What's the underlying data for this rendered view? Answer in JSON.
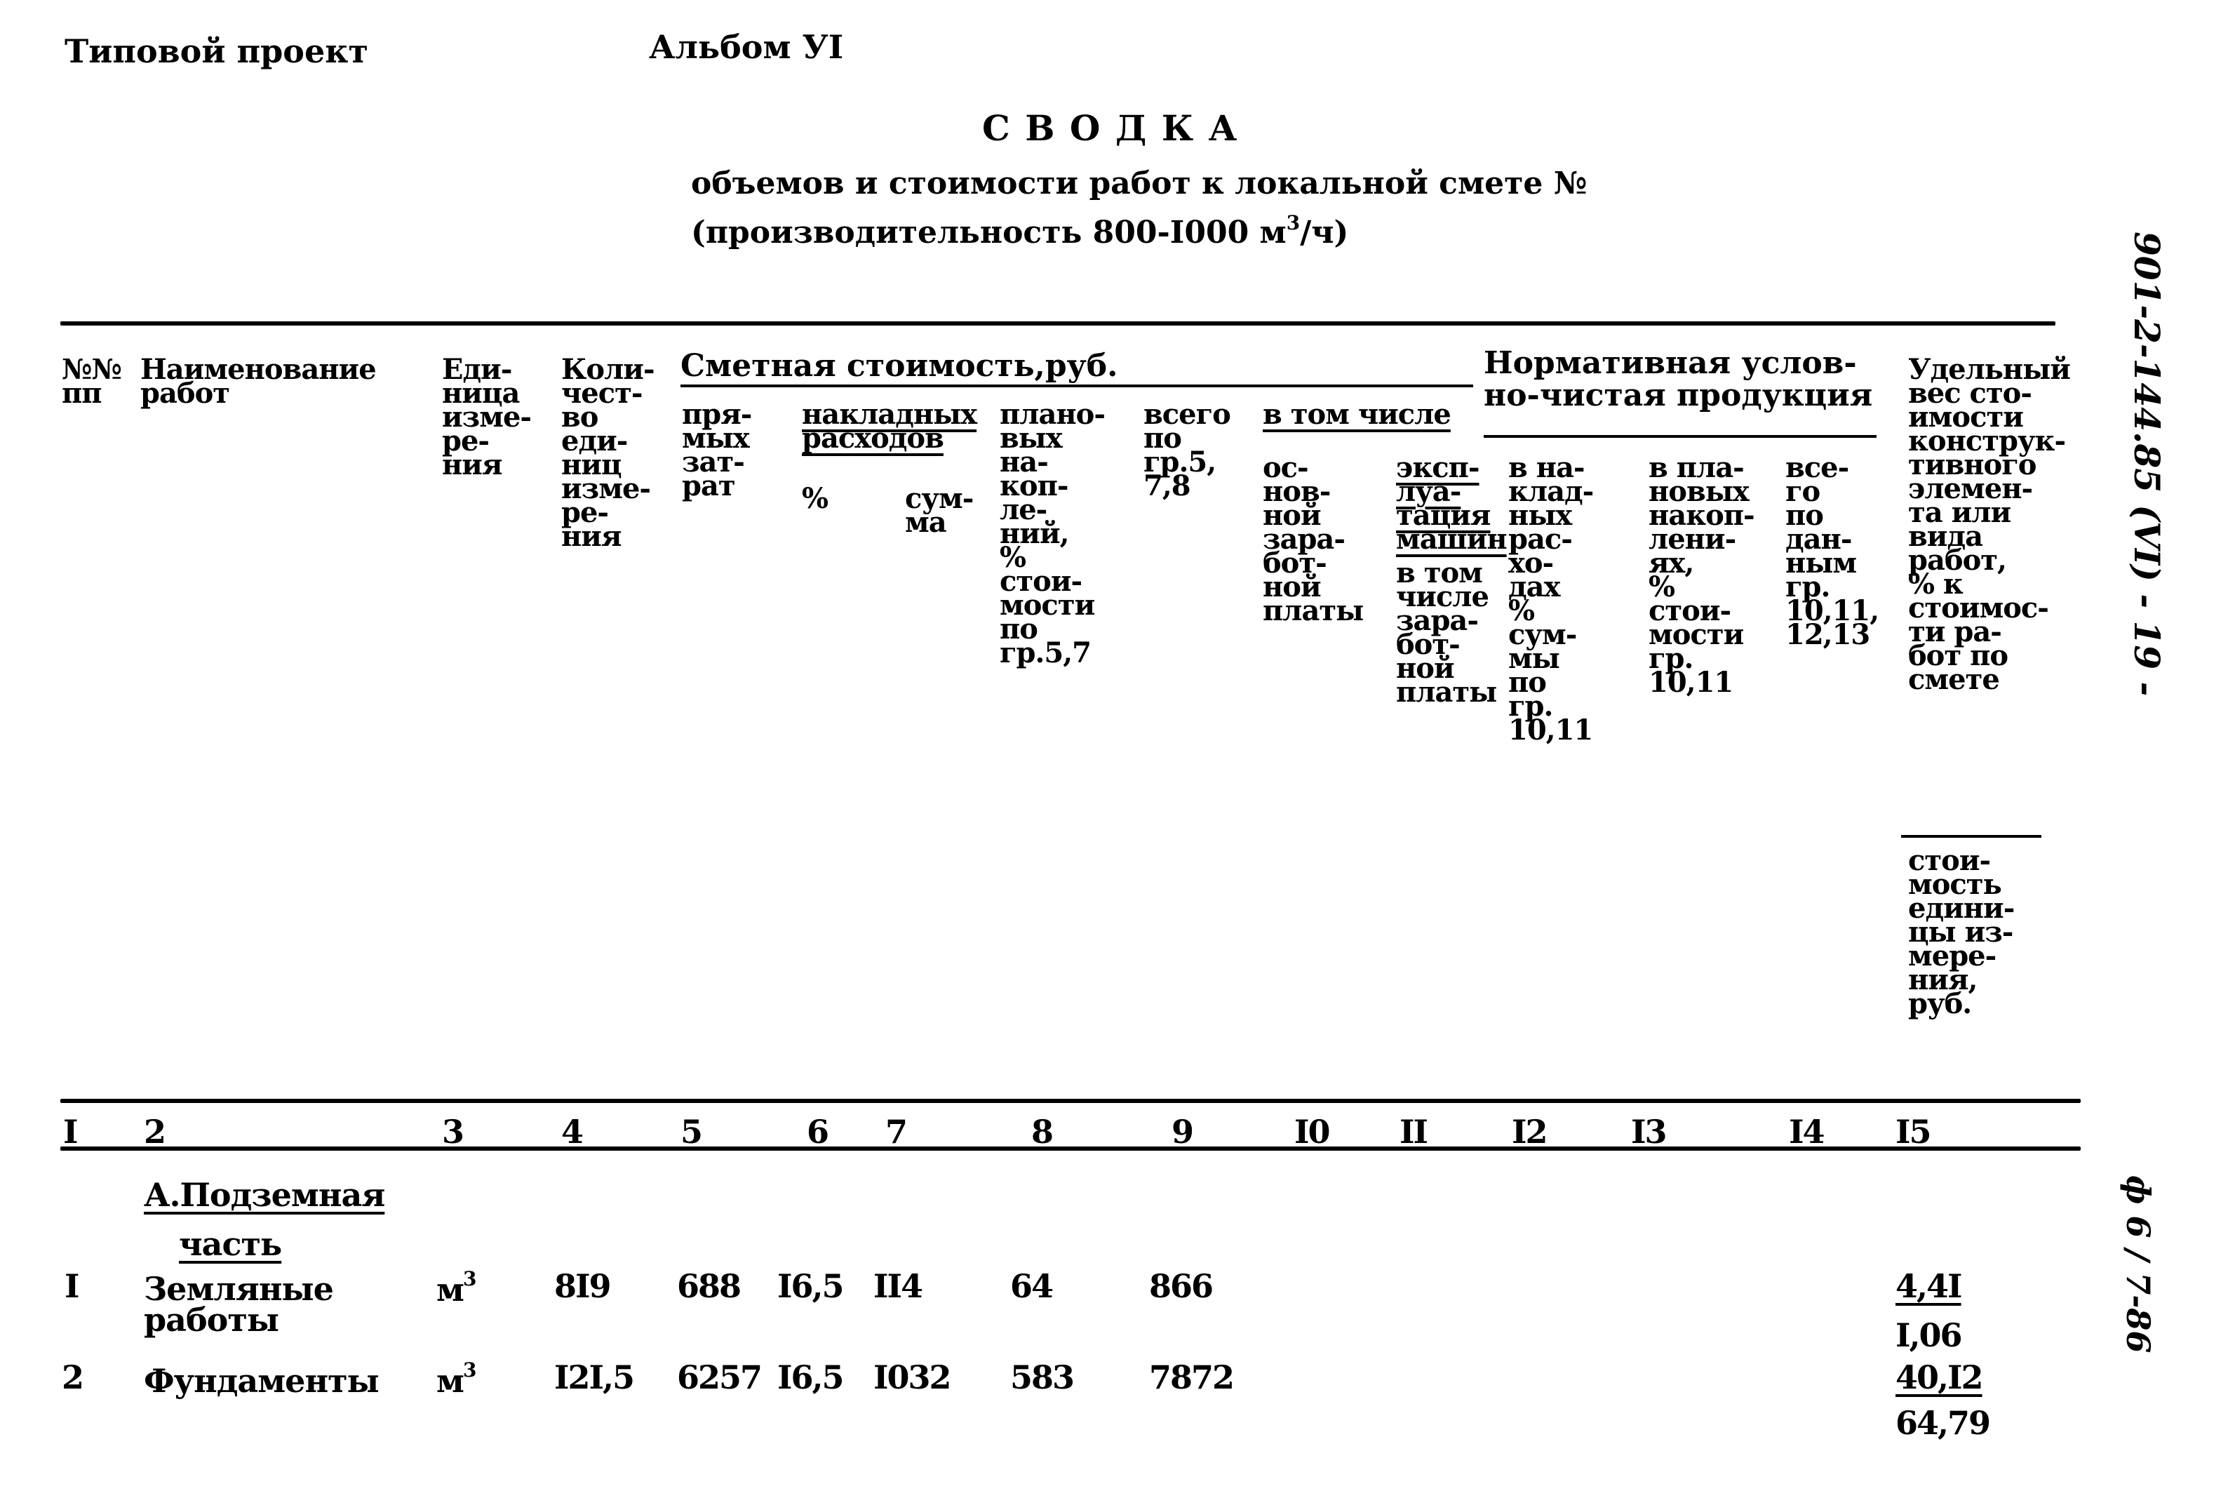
{
  "page": {
    "top_left": "Типовой проект",
    "album": "Альбом УI",
    "title": "С В О Д К А",
    "subtitle_line1": "объемов и стоимости работ к локальной смете №",
    "subtitle_line2_prefix": "(производительность 800-I000 м",
    "subtitle_line2_sup": "3",
    "subtitle_line2_suffix": "/ч)"
  },
  "margin_notes": {
    "right_top": "901-2-144.85 (VI) - 19 -",
    "right_bottom": "ф 6 / 7-86"
  },
  "table": {
    "headers": {
      "col1": "№№\nпп",
      "col2": "Наименование\nработ",
      "col3": "Еди-\nница\nизме-\nре-\nния",
      "col4": "Коли-\nчест-\nво\nеди-\nниц\nизме-\nре-\nния",
      "group_cost": "Сметная стоимость,руб.",
      "col5": "пря-\nмых\nзат-\nрат",
      "group_overhead": "накладных\nрасходов",
      "col6": "%",
      "col7": "сум-\nма",
      "col8": "плано-\nвых\nна-\nкоп-\nле-\nний,\n%\nстои-\nмости\nпо\nгр.5,7",
      "col9": "всего\nпо\nгр.5,\n7,8",
      "group_including": "в том числе",
      "col10": "ос-\nнов-\nной\nзара-\nбот-\nной\nплаты",
      "col11_top": "эксп-\nлуа-\nтация\nмашин",
      "col11_bottom": "в том\nчисле\nзара-\nбот-\nной\nплаты",
      "group_norm_line1": "Нормативная услов-",
      "group_norm_line2": "но-чистая продукция",
      "col12": "в на-\nклад-\nных\nрас-\nхо-\nдах\n%\nсум-\nмы\nпо\nгр.\n10,11",
      "col13": "в пла-\nновых\nнакоп-\nлени-\nях,\n%\nстои-\nмости\nгр.\n10,11",
      "col14": "все-\nго\nпо\nдан-\nным\nгр.\n10,11,\n12,13",
      "col15_top": "Удельный\nвес сто-\nимости\nконструк-\nтивного\nэлемен-\nта или\nвида\nработ,\n% к\nстоимос-\nти ра-\nбот по\nсмете",
      "col15_bottom": "стои-\nмость\nедини-\nцы из-\nмере-\nния,\nруб."
    },
    "column_numbers": [
      "I",
      "2",
      "3",
      "4",
      "5",
      "6",
      "7",
      "8",
      "9",
      "I0",
      "II",
      "I2",
      "I3",
      "I4",
      "I5"
    ],
    "section": {
      "line1": "А.Подземная",
      "line2": "часть"
    },
    "rows": [
      {
        "num": "I",
        "name": "Земляные\nработы",
        "unit": "м",
        "unit_sup": "3",
        "qty": "8I9",
        "direct": "688",
        "overhead_pct": "I6,5",
        "overhead_sum": "II4",
        "planned": "64",
        "total": "866",
        "c10": "",
        "c11": "",
        "c12": "",
        "c13": "",
        "c14": "",
        "share_pct": "4,4I",
        "unit_cost": "I,06"
      },
      {
        "num": "2",
        "name": "Фундаменты",
        "unit": "м",
        "unit_sup": "3",
        "qty": "I2I,5",
        "direct": "6257",
        "overhead_pct": "I6,5",
        "overhead_sum": "I032",
        "planned": "583",
        "total": "7872",
        "c10": "",
        "c11": "",
        "c12": "",
        "c13": "",
        "c14": "",
        "share_pct": "40,I2",
        "unit_cost": "64,79"
      }
    ]
  }
}
